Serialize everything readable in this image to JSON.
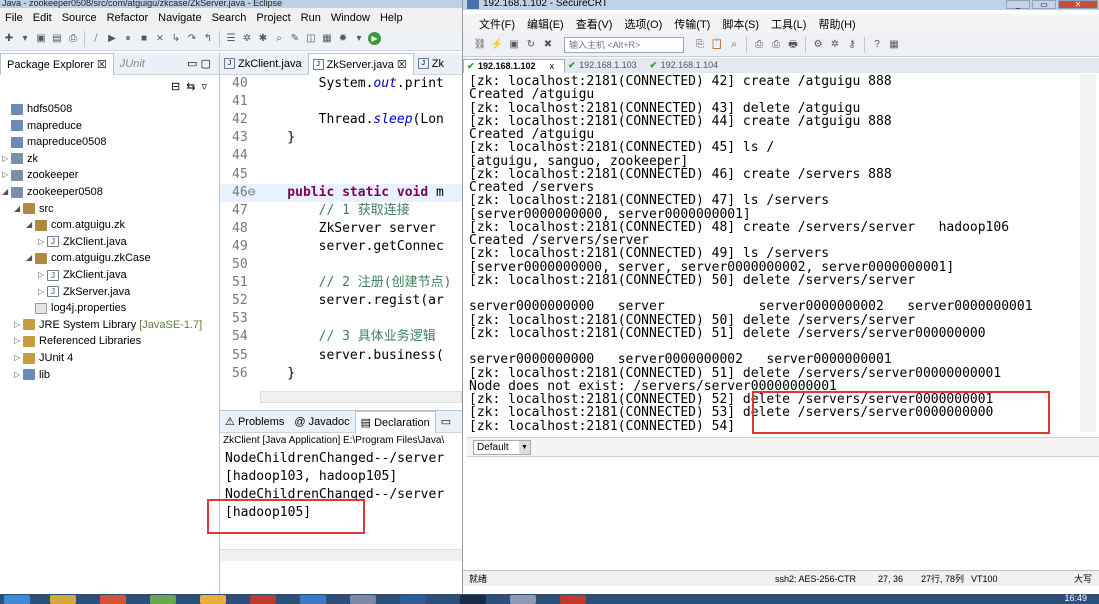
{
  "eclipse": {
    "title": "Java - zookeeper0508/src/com/atguigu/zkcase/ZkServer.java - Eclipse",
    "menu": [
      "File",
      "Edit",
      "Source",
      "Refactor",
      "Navigate",
      "Search",
      "Project",
      "Run",
      "Window",
      "Help"
    ],
    "explorer_tab": "Package Explorer",
    "junit_tab": "JUnit",
    "tree": [
      {
        "label": "hdfs0508",
        "depth": 0,
        "kind": "fold",
        "tw": ""
      },
      {
        "label": "mapreduce",
        "depth": 0,
        "kind": "fold",
        "tw": ""
      },
      {
        "label": "mapreduce0508",
        "depth": 0,
        "kind": "fold",
        "tw": ""
      },
      {
        "label": "zk",
        "depth": 0,
        "kind": "proj",
        "tw": "▷"
      },
      {
        "label": "zookeeper",
        "depth": 0,
        "kind": "proj",
        "tw": "▷"
      },
      {
        "label": "zookeeper0508",
        "depth": 0,
        "kind": "proj",
        "tw": "◢"
      },
      {
        "label": "src",
        "depth": 1,
        "kind": "pkg",
        "tw": "◢"
      },
      {
        "label": "com.atguigu.zk",
        "depth": 2,
        "kind": "pkg",
        "tw": "◢"
      },
      {
        "label": "ZkClient.java",
        "depth": 3,
        "kind": "jfile",
        "tw": "▷"
      },
      {
        "label": "com.atguigu.zkCase",
        "depth": 2,
        "kind": "pkg",
        "tw": "◢"
      },
      {
        "label": "ZkClient.java",
        "depth": 3,
        "kind": "jfile",
        "tw": "▷"
      },
      {
        "label": "ZkServer.java",
        "depth": 3,
        "kind": "jfile",
        "tw": "▷"
      },
      {
        "label": "log4j.properties",
        "depth": 2,
        "kind": "prop",
        "tw": ""
      },
      {
        "label": "JRE System Library",
        "suffix": "[JavaSE-1.7]",
        "depth": 1,
        "kind": "lib",
        "tw": "▷"
      },
      {
        "label": "Referenced Libraries",
        "depth": 1,
        "kind": "lib",
        "tw": "▷"
      },
      {
        "label": "JUnit 4",
        "depth": 1,
        "kind": "lib",
        "tw": "▷"
      },
      {
        "label": "lib",
        "depth": 1,
        "kind": "fold",
        "tw": "▷"
      }
    ],
    "editor_tabs": [
      "ZkClient.java",
      "ZkServer.java",
      "Zk"
    ],
    "code": [
      {
        "n": "40",
        "t": "        System.",
        "it": "out",
        "r": ".print"
      },
      {
        "n": "41",
        "t": ""
      },
      {
        "n": "42",
        "t": "        Thread.",
        "it2": "sleep",
        "r": "(Lon"
      },
      {
        "n": "43",
        "t": "    }"
      },
      {
        "n": "44",
        "t": ""
      },
      {
        "n": "45",
        "t": ""
      },
      {
        "n": "46⊖",
        "kw": "    public static void ",
        "r": "m"
      },
      {
        "n": "47",
        "cm": "        // 1 获取连接"
      },
      {
        "n": "48",
        "t": "        ZkServer server"
      },
      {
        "n": "49",
        "t": "        server.getConnec"
      },
      {
        "n": "50",
        "t": ""
      },
      {
        "n": "51",
        "cm": "        // 2 注册(创建节点)"
      },
      {
        "n": "52",
        "t": "        server.regist(ar"
      },
      {
        "n": "53",
        "t": ""
      },
      {
        "n": "54",
        "cm": "        // 3 具体业务逻辑"
      },
      {
        "n": "55",
        "t": "        server.business("
      },
      {
        "n": "56",
        "t": "    }"
      }
    ],
    "bottom_tabs": [
      "Problems",
      "Javadoc",
      "Declaration"
    ],
    "console_header": "ZkClient [Java Application] E:\\Program Files\\Java\\",
    "console": [
      "NodeChildrenChanged--/server",
      "[hadoop103, hadoop105]",
      "NodeChildrenChanged--/server",
      "[hadoop105]"
    ]
  },
  "crt": {
    "title": "192.168.1.102 - SecureCRT",
    "menu": [
      "文件(F)",
      "编辑(E)",
      "查看(V)",
      "选项(O)",
      "传输(T)",
      "脚本(S)",
      "工具(L)",
      "帮助(H)"
    ],
    "host_placeholder": "输入主机 <Alt+R>",
    "tabs": [
      "192.168.1.102",
      "192.168.1.103",
      "192.168.1.104"
    ],
    "lines": [
      "[zk: localhost:2181(CONNECTED) 42] create /atguigu 888",
      "Created /atguigu",
      "[zk: localhost:2181(CONNECTED) 43] delete /atguigu",
      "[zk: localhost:2181(CONNECTED) 44] create /atguigu 888",
      "Created /atguigu",
      "[zk: localhost:2181(CONNECTED) 45] ls /",
      "[atguigu, sanguo, zookeeper]",
      "[zk: localhost:2181(CONNECTED) 46] create /servers 888",
      "Created /servers",
      "[zk: localhost:2181(CONNECTED) 47] ls /servers",
      "[server0000000000, server0000000001]",
      "[zk: localhost:2181(CONNECTED) 48] create /servers/server   hadoop106",
      "Created /servers/server",
      "[zk: localhost:2181(CONNECTED) 49] ls /servers",
      "[server0000000000, server, server0000000002, server0000000001]",
      "[zk: localhost:2181(CONNECTED) 50] delete /servers/server",
      "",
      "server0000000000   server            server0000000002   server0000000001",
      "[zk: localhost:2181(CONNECTED) 50] delete /servers/server",
      "[zk: localhost:2181(CONNECTED) 51] delete /servers/server000000000",
      "",
      "server0000000000   server0000000002   server0000000001",
      "[zk: localhost:2181(CONNECTED) 51] delete /servers/server00000000001",
      "Node does not exist: /servers/server00000000001",
      "[zk: localhost:2181(CONNECTED) 52] delete /servers/server0000000001",
      "[zk: localhost:2181(CONNECTED) 53] delete /servers/server0000000000",
      "[zk: localhost:2181(CONNECTED) 54]"
    ],
    "session": "Default",
    "status": {
      "ready": "就绪",
      "ssh": "ssh2: AES-256-CTR",
      "pos": "27,  36",
      "size": "27行, 78列",
      "term": "VT100",
      "caps": "大写"
    }
  },
  "clock": "16:49",
  "colors": {
    "highlight_box": "#d9393a"
  }
}
